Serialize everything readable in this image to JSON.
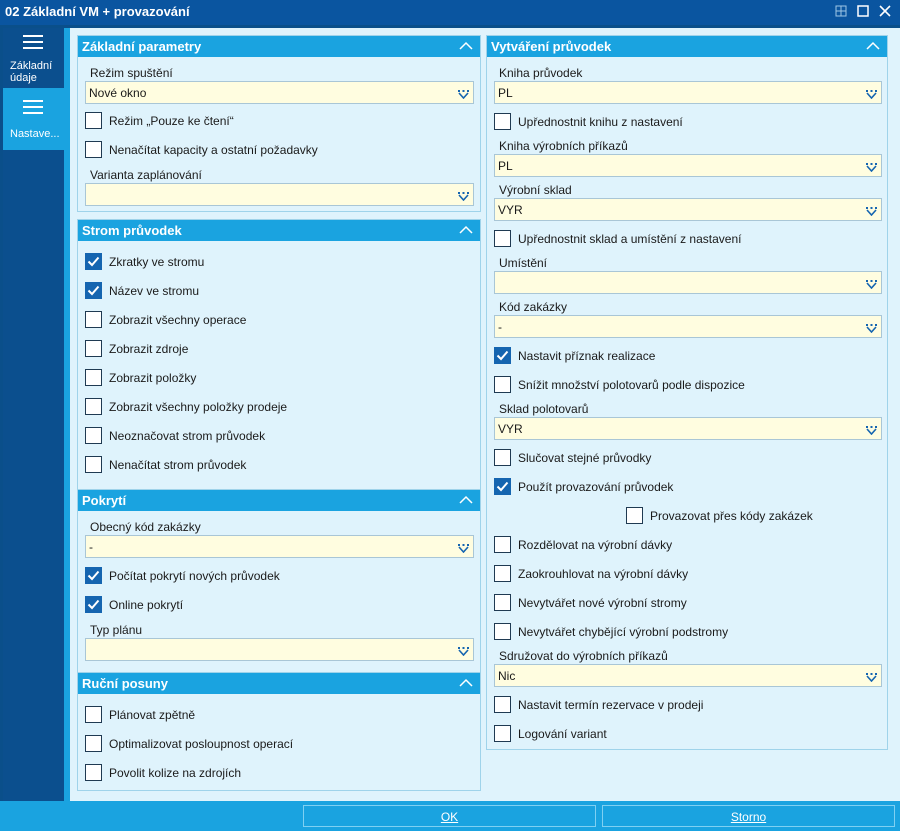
{
  "window": {
    "title": "02 Základní VM + provazování"
  },
  "sidebar": {
    "items": [
      {
        "label_line1": "Základní",
        "label_line2": "údaje"
      },
      {
        "label_line1": "Nastave...",
        "label_line2": ""
      }
    ]
  },
  "basic": {
    "title": "Základní parametry",
    "run_mode_label": "Režim spuštění",
    "run_mode_value": "Nové okno",
    "readonly_label": "Režim „Pouze ke čtení“",
    "readonly_checked": false,
    "noload_label": "Nenačítat kapacity a ostatní požadavky",
    "noload_checked": false,
    "plan_variant_label": "Varianta zaplánování",
    "plan_variant_value": ""
  },
  "tree": {
    "title": "Strom průvodek",
    "items": [
      {
        "label": "Zkratky ve stromu",
        "checked": true
      },
      {
        "label": "Název ve stromu",
        "checked": true
      },
      {
        "label": "Zobrazit všechny operace",
        "checked": false
      },
      {
        "label": "Zobrazit zdroje",
        "checked": false
      },
      {
        "label": "Zobrazit položky",
        "checked": false
      },
      {
        "label": "Zobrazit všechny položky prodeje",
        "checked": false
      },
      {
        "label": "Neoznačovat strom průvodek",
        "checked": false
      },
      {
        "label": "Nenačítat strom průvodek",
        "checked": false
      }
    ]
  },
  "coverage": {
    "title": "Pokrytí",
    "order_code_label": "Obecný kód zakázky",
    "order_code_value": "-",
    "calc_label": "Počítat pokrytí nových průvodek",
    "calc_checked": true,
    "online_label": "Online pokrytí",
    "online_checked": true,
    "plan_type_label": "Typ plánu",
    "plan_type_value": ""
  },
  "manual": {
    "title": "Ruční posuny",
    "items": [
      {
        "label": "Plánovat zpětně",
        "checked": false
      },
      {
        "label": "Optimalizovat posloupnost operací",
        "checked": false
      },
      {
        "label": "Povolit kolize na zdrojích",
        "checked": false
      }
    ]
  },
  "creation": {
    "title": "Vytváření průvodek",
    "book_label": "Kniha průvodek",
    "book_value": "PL",
    "prefer_book_label": "Upřednostnit knihu z nastavení",
    "prefer_book_checked": false,
    "orders_book_label": "Kniha výrobních příkazů",
    "orders_book_value": "PL",
    "warehouse_label": "Výrobní sklad",
    "warehouse_value": "VYR",
    "prefer_wh_label": "Upřednostnit sklad a umístění z nastavení",
    "prefer_wh_checked": false,
    "location_label": "Umístění",
    "location_value": "",
    "order_code_label": "Kód zakázky",
    "order_code_value": "-",
    "realization_label": "Nastavit příznak realizace",
    "realization_checked": true,
    "reduce_label": "Snížit množství polotovarů podle dispozice",
    "reduce_checked": false,
    "semi_wh_label": "Sklad polotovarů",
    "semi_wh_value": "VYR",
    "merge_label": "Slučovat stejné průvodky",
    "merge_checked": false,
    "linking_label": "Použít provazování průvodek",
    "linking_checked": true,
    "link_codes_label": "Provazovat přes kódy zakázek",
    "link_codes_checked": false,
    "split_label": "Rozdělovat na výrobní dávky",
    "split_checked": false,
    "round_label": "Zaokrouhlovat na výrobní dávky",
    "round_checked": false,
    "no_trees_label": "Nevytvářet nové výrobní stromy",
    "no_trees_checked": false,
    "no_subtrees_label": "Nevytvářet chybějící výrobní podstromy",
    "no_subtrees_checked": false,
    "group_label": "Sdružovat do výrobních příkazů",
    "group_value": "Nic",
    "reservation_label": "Nastavit termín rezervace v prodeji",
    "reservation_checked": false,
    "logging_label": "Logování variant",
    "logging_checked": false
  },
  "footer": {
    "ok_label": "OK",
    "cancel_label": "Storno"
  }
}
